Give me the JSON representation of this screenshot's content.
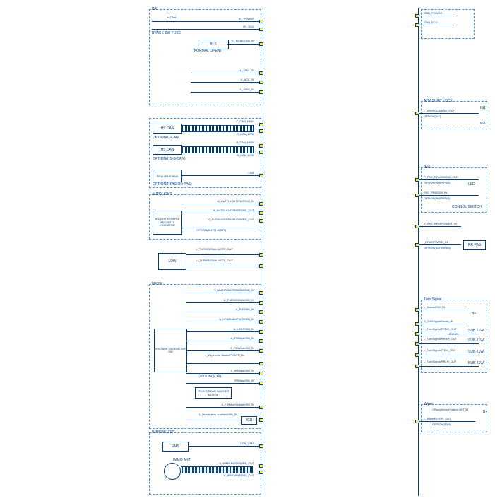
{
  "left_groups": {
    "bat": {
      "title": "BAT",
      "fuse": "FUSE",
      "brake_sw_fuse": "BRAKE SW FUSE",
      "b_power": "B+_POWER",
      "b_ecu": "B+_ECU",
      "bls": "BLS",
      "bls_sub": "(NORMAL OPEN)",
      "l_brakesw": "L_BRAKESW_IN",
      "ign1": "A_IGN1_IN",
      "acc": "A_ACC_IN",
      "ign2": "A_IGN2_IN"
    },
    "can": {
      "hscan": "HS CAN",
      "opt_ccan": "OPTION(C-CAN)",
      "c_high": "C_CAN_HIGH",
      "c_low": "C_CAN_LOW",
      "b_high": "B_CAN_HIGH",
      "b_low": "B_CAN_LOW",
      "opt_hsb": "OPTION(HS-B-CAN)",
      "pdw": "PDW OR R-PAW",
      "opt_rpas": "OPTION(RPAS OR PAS)",
      "lin1": "LIN1"
    },
    "autolight": {
      "title": "AUTOLIGHT",
      "sensor": "A/LIGHT SENSR & SECURITY INDICATOR",
      "sig1": "A_AUTOLIGHTSNSRSIG_IN",
      "sig2": "A_AUTOLIGHTSNSRGND_OUT",
      "sig3": "V_AUTOLIGHTSNSR POWER_OUT",
      "sig3b": "OPTION(AUTO LIGHT)"
    },
    "ldw": {
      "box": "LDW",
      "sig1": "L_TURNSIGNAL ACTR_OUT",
      "sig2": "L_TURNSIGNAL ACTL_OUT"
    },
    "mfsw": {
      "title": "MFSW",
      "box": "VOLTAGE DIVIDED M/F SW",
      "s1": "V_MUTIFUNCTIONSWGND_IN",
      "s2": "A_TURNSIGNALSW_IN",
      "s3": "A_FOGSW_IN",
      "s4": "A_HEADLAMPHIGHSW_IN",
      "s5": "A_LIGHTSW_IN",
      "s6": "A_FRWiperSW_IN",
      "s7": "A_RRWiperSW_IN",
      "s8": "L_WiperLow BackUPSWFR_IN",
      "opt_sdr": "OPTION(SDR)",
      "s9": "L_RRWashSW_IN",
      "s10": "FRWashSW_IN",
      "washer": "FRONT/REAR WASHER MOTOR",
      "s11": "A_FRWiperVolumeSW_IN",
      "s12": "L_HeadLamp LowBackSW_IN",
      "icu": "ICU"
    },
    "immo": {
      "title": "IMMOBILIZER",
      "ems": "EMS",
      "com_ems": "COM_EMS",
      "immo_ant": "IMMO ANT",
      "p1": "V_IMMOANTPOWER_OUT",
      "p2": "V_IMMOANTGND_OUT"
    }
  },
  "right_groups": {
    "gnd": {
      "p": "GND_POWER",
      "e": "GND_ECU"
    },
    "atm": {
      "title": "ATM SHIFT LOCK",
      "sig": "L_ATMSOLENOID_OUT",
      "opt": "OPTION(A/T)",
      "ig1": "IG1"
    },
    "pas": {
      "title": "PAS",
      "s1": "P_PAS_RPASSWIND_OUT",
      "opt1": "OPTION(PAS/RPAS)",
      "led": "LED",
      "s2": "PAS_RPASSW_IN",
      "opt2": "OPTION(PAS/RPAS)",
      "consol": "CONSOL SWITCH",
      "s3": "V_PAS_RPASPOWER_IN",
      "s4": "_RPASPOWER_IN",
      "opt3": "OPTION(SDR/RPAS)",
      "rrpas": "RR PAS"
    },
    "turn": {
      "title": "Turn Signal",
      "hazard": "L_HazardSW_IN",
      "bp": "B+",
      "pwr": "V_TurnSignalPower_IN",
      "frrh": "L_TurnSignal FRRH_OUT",
      "rrrh": "L_TurnSignal RRRH_OUT",
      "frlh": "L_TurnSignal FRLH_OUT",
      "rrlh": "L_TurnSignal RRLH_OUT",
      "sub": "SUB 21W",
      "b555w": "B 55.5W",
      "b21w": "BUB 21W"
    },
    "wiper": {
      "title": "Wiper",
      "opt": "OPtion(ServicePosition) MOTOR",
      "sig": "L_WiperRLYRR_OUT",
      "opt2": "OPTION(SDR)",
      "bp": "B+"
    }
  }
}
